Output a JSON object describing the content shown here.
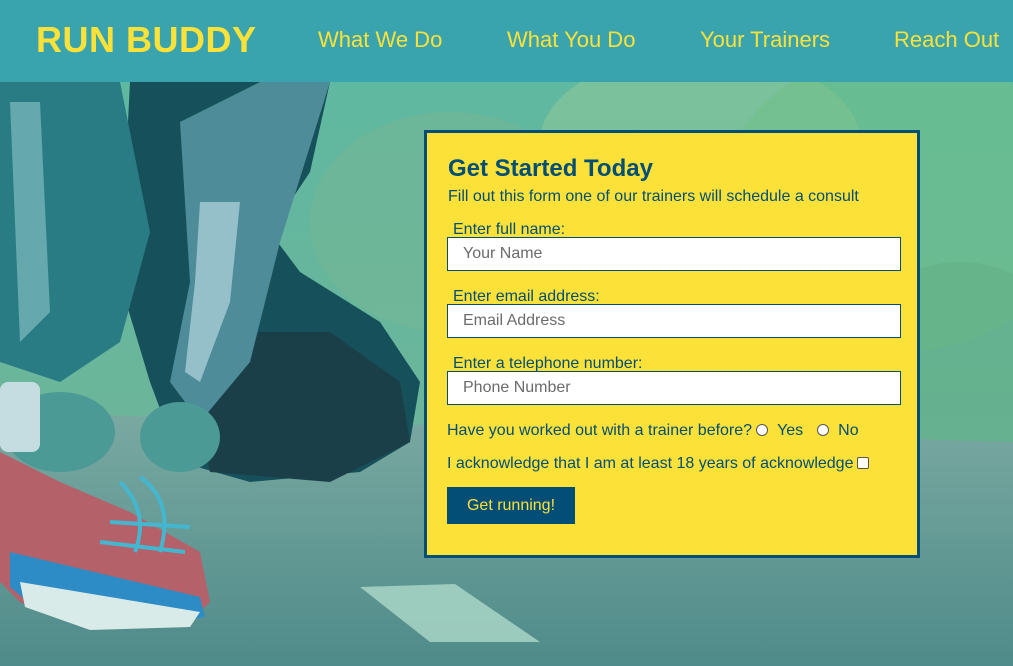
{
  "header": {
    "brand": "RUN BUDDY",
    "nav": [
      "What We Do",
      "What You Do",
      "Your Trainers",
      "Reach Out"
    ]
  },
  "colors": {
    "primary_blue": "#024e76",
    "accent_yellow": "#fce138",
    "header_teal": "#39a4ae"
  },
  "hero": {
    "image": "runner-tying-shoelace-photo"
  },
  "form": {
    "title": "Get Started Today",
    "subtitle": "Fill out this form one of our trainers will schedule a consult",
    "fields": [
      {
        "label": "Enter full name:",
        "placeholder": "Your Name"
      },
      {
        "label": "Enter email address:",
        "placeholder": "Email Address"
      },
      {
        "label": "Enter a telephone number:",
        "placeholder": "Phone Number"
      }
    ],
    "trainer_question": "Have you worked out with a trainer before?",
    "yes_label": "Yes",
    "no_label": "No",
    "ack_label": "I acknowledge that I am at least 18 years of acknowledge",
    "submit_label": "Get running!"
  }
}
